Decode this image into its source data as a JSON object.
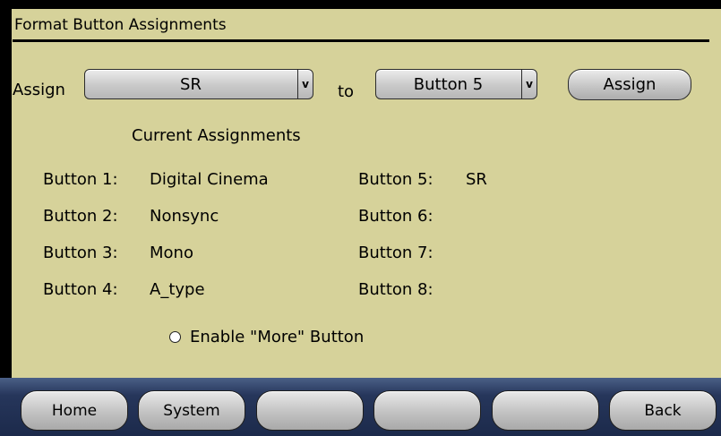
{
  "header": {
    "title": "Format Button Assignments"
  },
  "assign_row": {
    "assign_label": "Assign",
    "source_value": "SR",
    "to_label": "to",
    "target_value": "Button 5",
    "dropdown_arrow": "v",
    "assign_button": "Assign"
  },
  "current": {
    "heading": "Current Assignments",
    "left": [
      {
        "label": "Button 1:",
        "value": "Digital Cinema"
      },
      {
        "label": "Button 2:",
        "value": "Nonsync"
      },
      {
        "label": "Button 3:",
        "value": "Mono"
      },
      {
        "label": "Button 4:",
        "value": "A_type"
      }
    ],
    "right": [
      {
        "label": "Button 5:",
        "value": "SR"
      },
      {
        "label": "Button 6:",
        "value": ""
      },
      {
        "label": "Button 7:",
        "value": ""
      },
      {
        "label": "Button 8:",
        "value": ""
      }
    ]
  },
  "more_option": {
    "label": "Enable \"More\" Button",
    "checked": false
  },
  "nav": [
    {
      "label": "Home"
    },
    {
      "label": "System"
    },
    {
      "label": ""
    },
    {
      "label": ""
    },
    {
      "label": ""
    },
    {
      "label": "Back"
    }
  ],
  "colors": {
    "panel": "#d6d29a",
    "nav_bar": "#26365b",
    "button_face": "#c6c6c6"
  }
}
